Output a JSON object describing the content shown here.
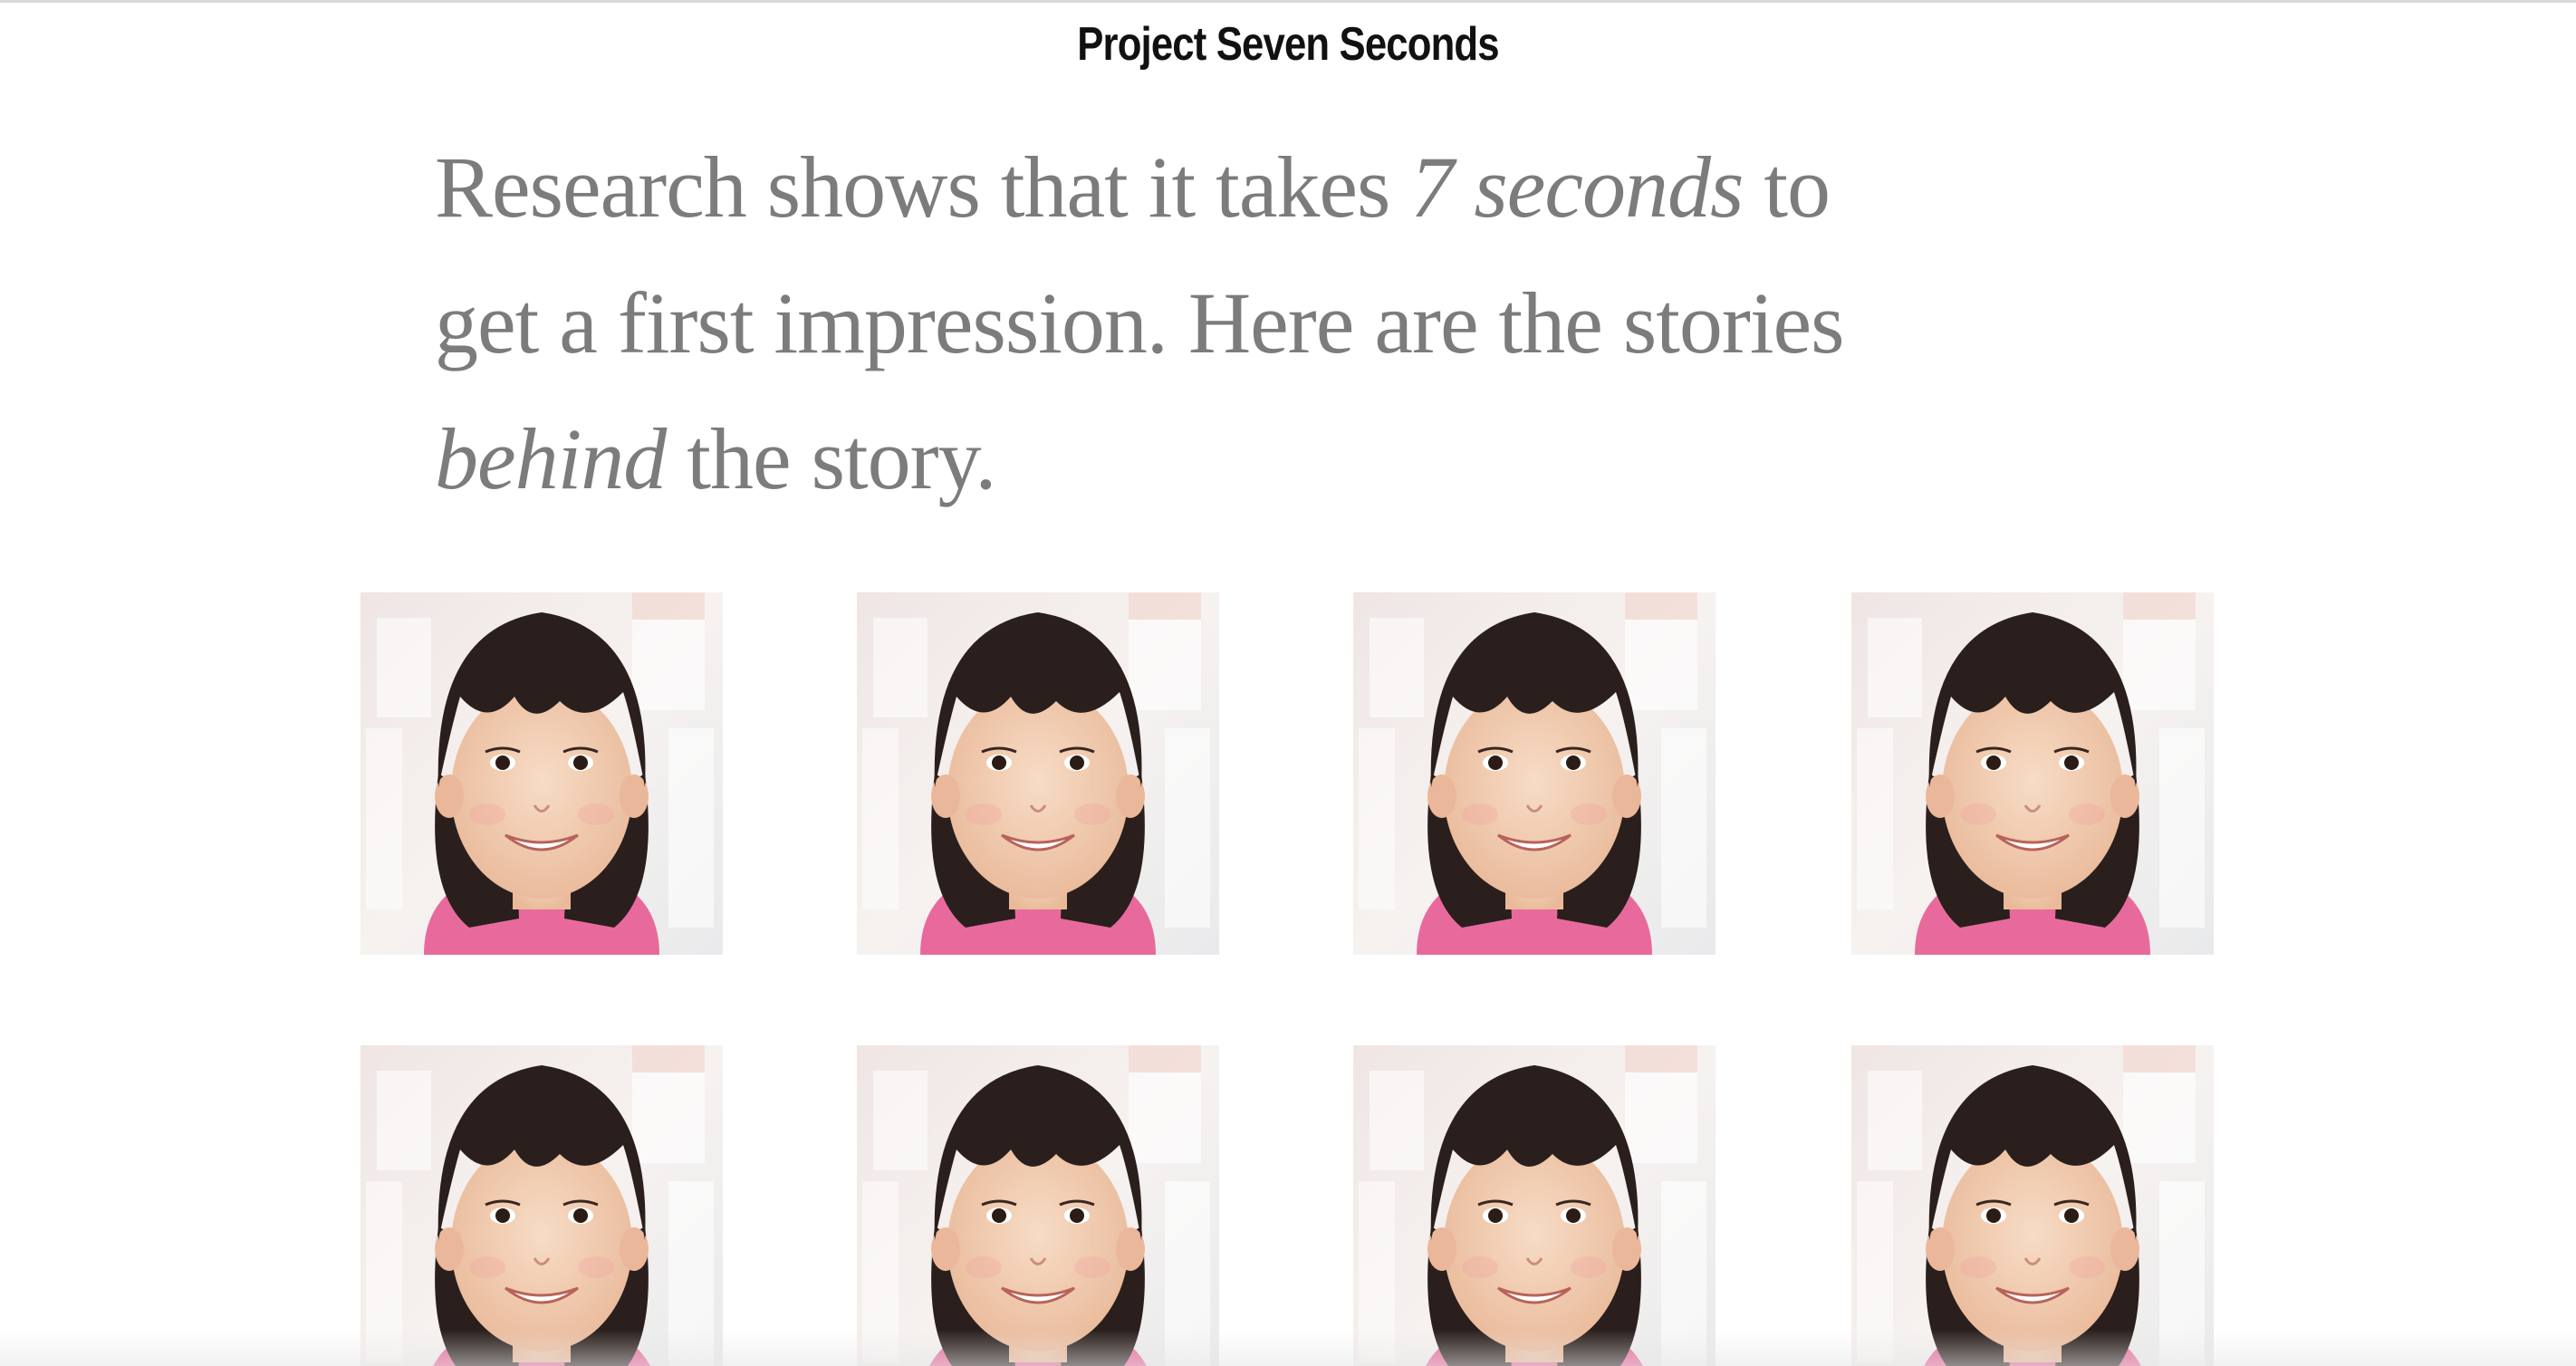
{
  "header": {
    "site_title": "Project Seven Seconds"
  },
  "intro": {
    "part1": "Research shows that it takes ",
    "emphasis1": "7 seconds",
    "part2": " to get a first impression. Here are the stories ",
    "emphasis2": "behind",
    "part3": " the story."
  },
  "gallery": {
    "items": [
      {
        "subject": "girl-portrait-photo"
      },
      {
        "subject": "girl-portrait-photo"
      },
      {
        "subject": "girl-portrait-photo"
      },
      {
        "subject": "girl-portrait-photo"
      },
      {
        "subject": "girl-portrait-photo"
      },
      {
        "subject": "girl-portrait-photo"
      },
      {
        "subject": "girl-portrait-photo"
      },
      {
        "subject": "girl-portrait-photo"
      }
    ]
  },
  "colors": {
    "title": "#111111",
    "intro_text": "#7c7c7c",
    "shirt": "#e86a9c",
    "hair": "#2a1f1c",
    "skin": "#f1cdb4",
    "background": "#ffffff"
  }
}
